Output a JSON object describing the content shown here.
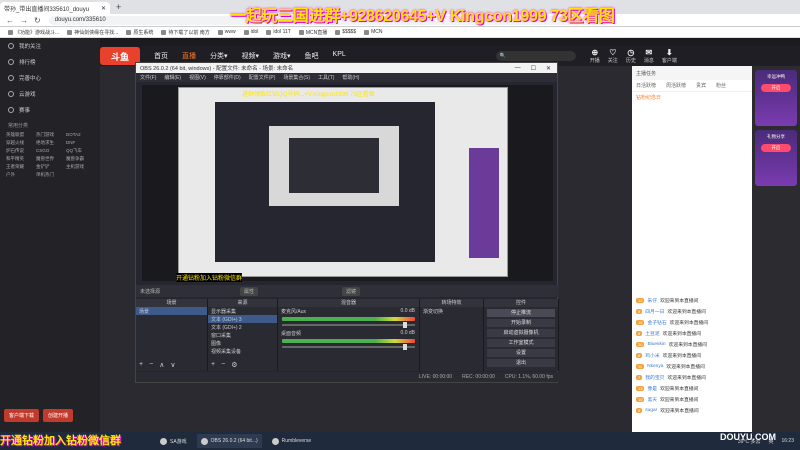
{
  "browser": {
    "tab1": "带孙_带出直播间335610_douyu",
    "tab2": "",
    "url": "douyu.com/335610",
    "bookmarks": [
      "《功能》游戏战斗...",
      "神仙剑侠缘在寻找...",
      "原生系统",
      "待下载了以前 南方",
      "www",
      "idol",
      "idol 11T",
      "MCN直播",
      "$$$$$",
      "MCN"
    ]
  },
  "overlay": {
    "top_text": "一起玩三国进群+928620645+V Kingcon1999 73区看图",
    "small_text": "进群领取红钻QQ号码...+V:Kingcon1999 73区看图",
    "low_text": "开通钻粉加入钻粉微信群",
    "bottom_text": "开通钻粉加入钻粉微信群"
  },
  "site": {
    "logo": "斗鱼",
    "nav": [
      "首页",
      "直播",
      "分类▾",
      "视频▾",
      "游戏▾",
      "鱼吧",
      "KPL"
    ],
    "active_nav": 1,
    "search_placeholder": "",
    "top_icons": [
      {
        "i": "⊕",
        "t": "开播"
      },
      {
        "i": "♡",
        "t": "关注"
      },
      {
        "i": "◷",
        "t": "历史"
      },
      {
        "i": "✉",
        "t": "消息"
      },
      {
        "i": "⬇",
        "t": "客户端"
      }
    ]
  },
  "sidebar": {
    "items": [
      "我的关注",
      "排行榜",
      "完善中心",
      "云游戏",
      "赛事"
    ],
    "section": "常用分类",
    "grid": [
      "英雄联盟",
      "热门游戏",
      "DOTA2",
      "穿越火线",
      "绝地求生",
      "DNF",
      "炉石传说",
      "CSGO",
      "QQ飞车",
      "和平精英",
      "魔兽世界",
      "魔兽争霸",
      "王者荣耀",
      "金铲铲",
      "主机游戏",
      "户外",
      "单机热门"
    ],
    "buttons": [
      "客户端下载",
      "创建开播"
    ]
  },
  "obs": {
    "title": "OBS 26.0.2 (64 bit, windows) - 配置文件: 未命名 - 场景: 未命名",
    "menu": [
      "文件(F)",
      "编辑(E)",
      "视图(V)",
      "停靠部件(D)",
      "配置文件(P)",
      "场景集合(S)",
      "工具(T)",
      "帮助(H)"
    ],
    "no_source": "未选择源",
    "props_btn": "属性",
    "filters_btn": "滤镜",
    "docks": {
      "scenes": {
        "title": "场景",
        "items": [
          "场景"
        ]
      },
      "sources": {
        "title": "来源",
        "items": [
          "显示器采集",
          "文本 (GDI+) 3",
          "文本 (GDI+) 2",
          "窗口采集",
          "图像",
          "视频采集设备"
        ]
      },
      "mixer": {
        "title": "混音器",
        "channels": [
          {
            "name": "麦克风/Aux",
            "db": "0.0 dB"
          },
          {
            "name": "桌面音频",
            "db": "0.0 dB"
          }
        ]
      },
      "transitions": {
        "title": "转场特效",
        "type": "渐变切换"
      },
      "controls": {
        "title": "控件",
        "buttons": [
          "停止推流",
          "开始录制",
          "启动虚拟摄像机",
          "工作室模式",
          "设置",
          "退出"
        ]
      }
    },
    "status": [
      "LIVE: 00:00:00",
      "REC: 00:00:00",
      "CPU: 1.1%, 60.00 fps"
    ]
  },
  "right": {
    "head": "主播任务",
    "tabs": [
      "日活跃榜",
      "周活跃榜",
      "贵宾",
      "粉丝"
    ],
    "rank_title": "钻粉纪念日",
    "chat": [
      {
        "lvl": "12",
        "name": "朱仔",
        "text": "欢迎来到本直播间"
      },
      {
        "lvl": "9",
        "name": "四月一日",
        "text": "欢迎来到本直播间"
      },
      {
        "lvl": "15",
        "name": "金子钻石",
        "text": "欢迎来到本直播间"
      },
      {
        "lvl": "8",
        "name": "土豆泥",
        "text": "欢迎来到本直播间"
      },
      {
        "lvl": "20",
        "name": "Blueskin",
        "text": "欢迎来到本直播间"
      },
      {
        "lvl": "6",
        "name": "鸡小米",
        "text": "欢迎来到本直播间"
      },
      {
        "lvl": "11",
        "name": "Nkenya",
        "text": "欢迎来到本直播间"
      },
      {
        "lvl": "7",
        "name": "我的宝贝",
        "text": "欢迎来到本直播间"
      },
      {
        "lvl": "13",
        "name": "像是",
        "text": "欢迎来到本直播间"
      },
      {
        "lvl": "10",
        "name": "黑天",
        "text": "欢迎来到本直播间"
      },
      {
        "lvl": "5",
        "name": "sugar",
        "text": "欢迎来到本直播间"
      }
    ]
  },
  "promo": {
    "card1": "幸运冲鸭",
    "card2": "礼物分享",
    "btn": "开启"
  },
  "taskbar": {
    "items": [
      "SA游戏",
      "OBS 26.0.2 (64 bit...)",
      "Rumbleverse"
    ],
    "tray": [
      "39°C 多云",
      "英",
      "16:23"
    ]
  },
  "watermark": "DOUYU.COM"
}
